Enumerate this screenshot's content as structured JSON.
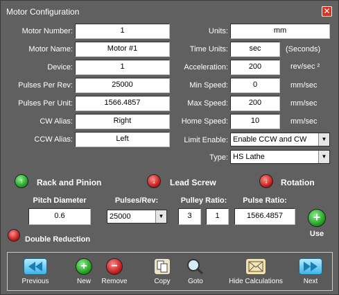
{
  "window": {
    "title": "Motor Configuration",
    "close_glyph": "✕"
  },
  "left_fields": [
    {
      "label": "Motor Number:",
      "value": "1"
    },
    {
      "label": "Motor Name:",
      "value": "Motor #1"
    },
    {
      "label": "Device:",
      "value": "1"
    },
    {
      "label": "Pulses Per Rev:",
      "value": "25000"
    },
    {
      "label": "Pulses Per Unit:",
      "value": "1566.4857"
    },
    {
      "label": "CW Alias:",
      "value": "Right"
    },
    {
      "label": "CCW Alias:",
      "value": "Left"
    }
  ],
  "right_fields": [
    {
      "label": "Units:",
      "value": "mm",
      "unit": ""
    },
    {
      "label": "Time Units:",
      "value": "sec",
      "unit": "(Seconds)"
    },
    {
      "label": "Acceleration:",
      "value": "200",
      "unit": "rev/sec ²"
    },
    {
      "label": "Min Speed:",
      "value": "0",
      "unit": "mm/sec"
    },
    {
      "label": "Max Speed:",
      "value": "200",
      "unit": "mm/sec"
    },
    {
      "label": "Home Speed:",
      "value": "10",
      "unit": "mm/sec"
    }
  ],
  "limit_enable": {
    "label": "Limit Enable:",
    "value": "Enable CCW and CW"
  },
  "type": {
    "label": "Type:",
    "value": "HS Lathe"
  },
  "options": {
    "rack_and_pinion": "Rack and Pinion",
    "lead_screw": "Lead Screw",
    "rotation": "Rotation",
    "double_reduction": "Double Reduction"
  },
  "calc": {
    "pitch_diameter_label": "Pitch Diameter",
    "pitch_diameter_value": "0.6",
    "pulses_rev_label": "Pulses/Rev:",
    "pulses_rev_value": "25000",
    "pulley_ratio_label": "Pulley Ratio:",
    "pulley_ratio_a": "3",
    "pulley_ratio_b": "1",
    "pulse_ratio_label": "Pulse Ratio:",
    "pulse_ratio_value": "1566.4857",
    "use_label": "Use"
  },
  "toolbar": {
    "previous": "Previous",
    "new": "New",
    "remove": "Remove",
    "copy": "Copy",
    "goto": "Goto",
    "hide_calculations": "Hide Calculations",
    "next": "Next"
  },
  "colors": {
    "background": "#606060",
    "green": "#1f9e1f",
    "red": "#c21a1a",
    "nav_blue": "#3db3e6",
    "close_red": "#e0301e"
  }
}
